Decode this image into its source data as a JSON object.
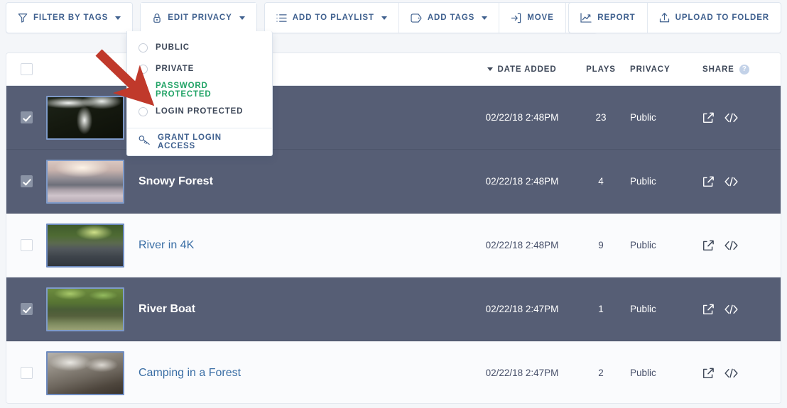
{
  "toolbar": {
    "groups": [
      {
        "name": "filter",
        "buttons": [
          {
            "label": "Filter by Tags",
            "icon": "funnel-icon",
            "caret": true
          }
        ]
      },
      {
        "name": "privacy",
        "buttons": [
          {
            "label": "Edit Privacy",
            "icon": "lock-icon",
            "caret": true
          }
        ]
      },
      {
        "name": "bulk",
        "buttons": [
          {
            "label": "Add to Playlist",
            "icon": "list-icon",
            "caret": true
          },
          {
            "label": "Add Tags",
            "icon": "tag-icon",
            "caret": true
          },
          {
            "label": "Move",
            "icon": "move-icon",
            "caret": false
          },
          {
            "label": "",
            "icon": "trash-icon",
            "caret": false
          }
        ]
      },
      {
        "name": "right",
        "buttons": [
          {
            "label": "Report",
            "icon": "chart-icon",
            "caret": false
          },
          {
            "label": "Upload to Folder",
            "icon": "upload-icon",
            "caret": false
          }
        ]
      }
    ]
  },
  "privacy_dropdown": {
    "open": true,
    "selected": "Password Protected",
    "accent_color": "#21a366",
    "options": [
      {
        "label": "Public",
        "selected": false
      },
      {
        "label": "Private",
        "selected": false
      },
      {
        "label": "Password Protected",
        "selected": true
      },
      {
        "label": "Login Protected",
        "selected": false
      }
    ],
    "footer": {
      "label": "Grant Login Access",
      "icon": "key-icon"
    }
  },
  "table": {
    "select_all_checked": false,
    "headers": {
      "date": "Date Added",
      "plays": "Plays",
      "privacy": "Privacy",
      "share": "Share",
      "share_help": "?"
    },
    "sort": {
      "column": "Date Added",
      "direction": "desc"
    },
    "rows": [
      {
        "title": "",
        "date": "02/22/18 2:48PM",
        "plays": "23",
        "privacy": "Public",
        "selected": true,
        "thumb": "forest-canopy"
      },
      {
        "title": "Snowy Forest",
        "date": "02/22/18 2:48PM",
        "plays": "4",
        "privacy": "Public",
        "selected": true,
        "thumb": "snowy-sunset"
      },
      {
        "title": "River in 4K",
        "date": "02/22/18 2:48PM",
        "plays": "9",
        "privacy": "Public",
        "selected": false,
        "thumb": "river-green"
      },
      {
        "title": "River Boat",
        "date": "02/22/18 2:47PM",
        "plays": "1",
        "privacy": "Public",
        "selected": true,
        "thumb": "river-boat"
      },
      {
        "title": "Camping in a Forest",
        "date": "02/22/18 2:47PM",
        "plays": "2",
        "privacy": "Public",
        "selected": false,
        "thumb": "camping-gray"
      }
    ],
    "row_icons": {
      "share": "share-arrow-icon",
      "embed": "code-brackets-icon"
    }
  },
  "annotation": {
    "arrow_color": "#c0392b",
    "points_to": "Password Protected"
  },
  "colors": {
    "selected_row_bg": "#565e75",
    "row_bg": "#fafbfd",
    "link": "#3a6ea5",
    "toolbar_text": "#40618f",
    "page_bg": "#f4f6f9"
  }
}
